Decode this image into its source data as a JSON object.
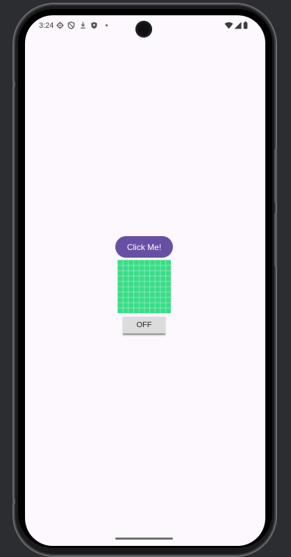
{
  "status_bar": {
    "time": "3:24",
    "icons": [
      "settings-gear-icon",
      "shield-outline-icon",
      "download-arrow-icon",
      "shield-filled-icon",
      "notification-dot-icon",
      "wifi-icon",
      "signal-icon",
      "battery-icon"
    ]
  },
  "main": {
    "click_button_label": "Click Me!",
    "toggle_button_label": "OFF"
  },
  "colors": {
    "screen_background": "#fdf7fe",
    "primary_button": "#6750a4",
    "grid_fill": "#3cdc88",
    "toggle_background": "#dcdcdc"
  }
}
